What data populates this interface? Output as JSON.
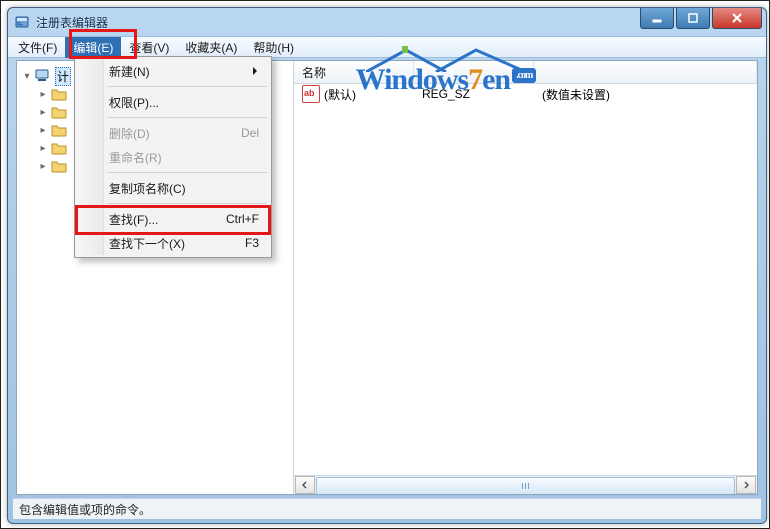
{
  "window": {
    "title": "注册表编辑器"
  },
  "menubar": {
    "items": [
      "文件(F)",
      "编辑(E)",
      "查看(V)",
      "收藏夹(A)",
      "帮助(H)"
    ],
    "open_index": 1
  },
  "edit_menu": {
    "items": [
      {
        "label": "新建(N)",
        "shortcut": "",
        "submenu": true,
        "enabled": true
      },
      {
        "sep": true
      },
      {
        "label": "权限(P)...",
        "shortcut": "",
        "enabled": true
      },
      {
        "sep": true
      },
      {
        "label": "删除(D)",
        "shortcut": "Del",
        "enabled": false
      },
      {
        "label": "重命名(R)",
        "shortcut": "",
        "enabled": false
      },
      {
        "sep": true
      },
      {
        "label": "复制项名称(C)",
        "shortcut": "",
        "enabled": true
      },
      {
        "sep": true
      },
      {
        "label": "查找(F)...",
        "shortcut": "Ctrl+F",
        "enabled": true
      },
      {
        "label": "查找下一个(X)",
        "shortcut": "F3",
        "enabled": true
      }
    ]
  },
  "tree": {
    "root": "计"
  },
  "list": {
    "columns": {
      "name": "名称",
      "type": "",
      "data": ""
    },
    "rows": [
      {
        "name": "(默认)",
        "type": "REG_SZ",
        "data": "(数值未设置)"
      }
    ]
  },
  "statusbar": {
    "text": "包含编辑值或项的命令。"
  },
  "watermark": {
    "brand_w": "W",
    "brand_rest": "indows",
    "brand_7": "7",
    "brand_en": "en",
    "badge": ".com"
  }
}
